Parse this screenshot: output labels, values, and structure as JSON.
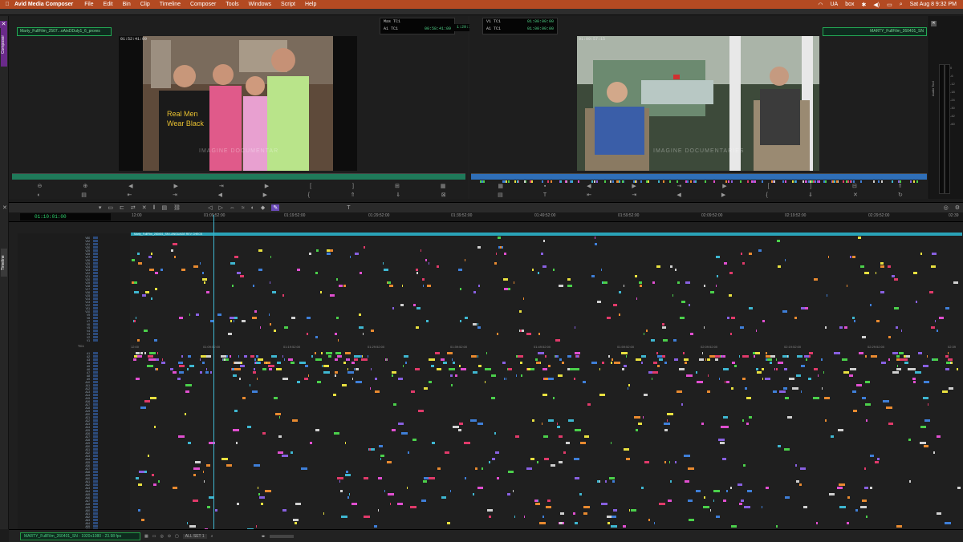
{
  "menubar": {
    "apple_icon": "apple-icon",
    "app_name": "Avid Media Composer",
    "items": [
      "File",
      "Edit",
      "Bin",
      "Clip",
      "Timeline",
      "Composer",
      "Tools",
      "Windows",
      "Script",
      "Help"
    ],
    "status_right": [
      "UA",
      "box"
    ],
    "datetime": "Sat Aug 8  9:32 PM"
  },
  "composer": {
    "tab_label": "Composer",
    "source_clip": "Marty_FullFilm_2507...oAtxDDuly1_6_prores",
    "record_clip": "MARTY_FullFilm_260401_SN",
    "source_frame_tc": "01:52:41:09",
    "record_frame_tc": "01:09:57:15",
    "center_tc": "1:29:35:03",
    "source_tc_rows": [
      {
        "label": "Mas  TC1",
        "value": ""
      },
      {
        "label": "A1  TC1",
        "value": "00:58:41:09"
      }
    ],
    "record_tc_rows": [
      {
        "label": "V1  TC1",
        "value": "01:00:00:00"
      },
      {
        "label": "A1  TC1",
        "value": "01:00:00:00"
      }
    ],
    "watermark_left": "IMAGINE DOCUMENTAR",
    "watermark_right": "IMAGINE DOCUMENTARIES"
  },
  "audio_tool": {
    "title": "Audio Tool",
    "scale": [
      "0",
      "-6",
      "-12",
      "-18",
      "-24",
      "-30",
      "-42",
      "-60"
    ]
  },
  "timeline": {
    "tab_label": "Timeline",
    "master_tc": "01:10:01:00",
    "ruler": [
      "12:00",
      "01:09:52:00",
      "01:19:52:00",
      "01:29:52:00",
      "01:39:52:00",
      "01:49:52:00",
      "01:59:52:00",
      "02:09:52:00",
      "02:19:52:00",
      "02:29:52:00",
      "02:39"
    ],
    "sequence_bar_label": "Marty_FullFilm_260401_SN   LANGUAGE  REV  CHECK",
    "tc_track": "TC1",
    "video_tracks": [
      "V60",
      "V32",
      "V31",
      "V30",
      "V29",
      "V28",
      "V27",
      "V26",
      "V25",
      "V24",
      "V23",
      "V22",
      "V21",
      "V20",
      "V19",
      "V18",
      "V17",
      "V16",
      "V15",
      "V14",
      "V13",
      "V12",
      "V11",
      "V10",
      "V9",
      "V8",
      "V7",
      "V6",
      "V5",
      "V4",
      "V3",
      "V2",
      "V1"
    ],
    "audio_tracks": [
      "A1",
      "A2",
      "A3",
      "A4",
      "A5",
      "A6",
      "A7",
      "A8",
      "A9",
      "A10",
      "A11",
      "A12",
      "A13",
      "A14",
      "A15",
      "A16",
      "A17",
      "A18",
      "A19",
      "A20",
      "A21",
      "A22",
      "A23",
      "A24",
      "A25",
      "A26",
      "A27",
      "A28",
      "A29",
      "A30",
      "A31",
      "A32",
      "A33",
      "A34",
      "A35",
      "A36",
      "A37",
      "A38",
      "A39",
      "A40",
      "A41",
      "A42",
      "A43",
      "A44",
      "A45",
      "A46",
      "A47",
      "A48",
      "A49",
      "A50",
      "A51",
      "A52",
      "A53",
      "A54",
      "A55",
      "A56",
      "A57",
      "A58"
    ]
  },
  "bottom_bar": {
    "sequence_info": "MARTY_FullFilm_260401_SN - 1920x1080 - 23.98 fps",
    "track_set": "ALL SET 1"
  },
  "colors": {
    "menubar": "#b34a22",
    "timecode_green": "#4ed186",
    "playhead": "#3fb7d1",
    "clip_palette": [
      "#4bd04b",
      "#3f7fd8",
      "#e04fd0",
      "#e8e040",
      "#e88a30",
      "#3fb7d1",
      "#d0d0d0",
      "#8860e0",
      "#e03a6a"
    ]
  }
}
